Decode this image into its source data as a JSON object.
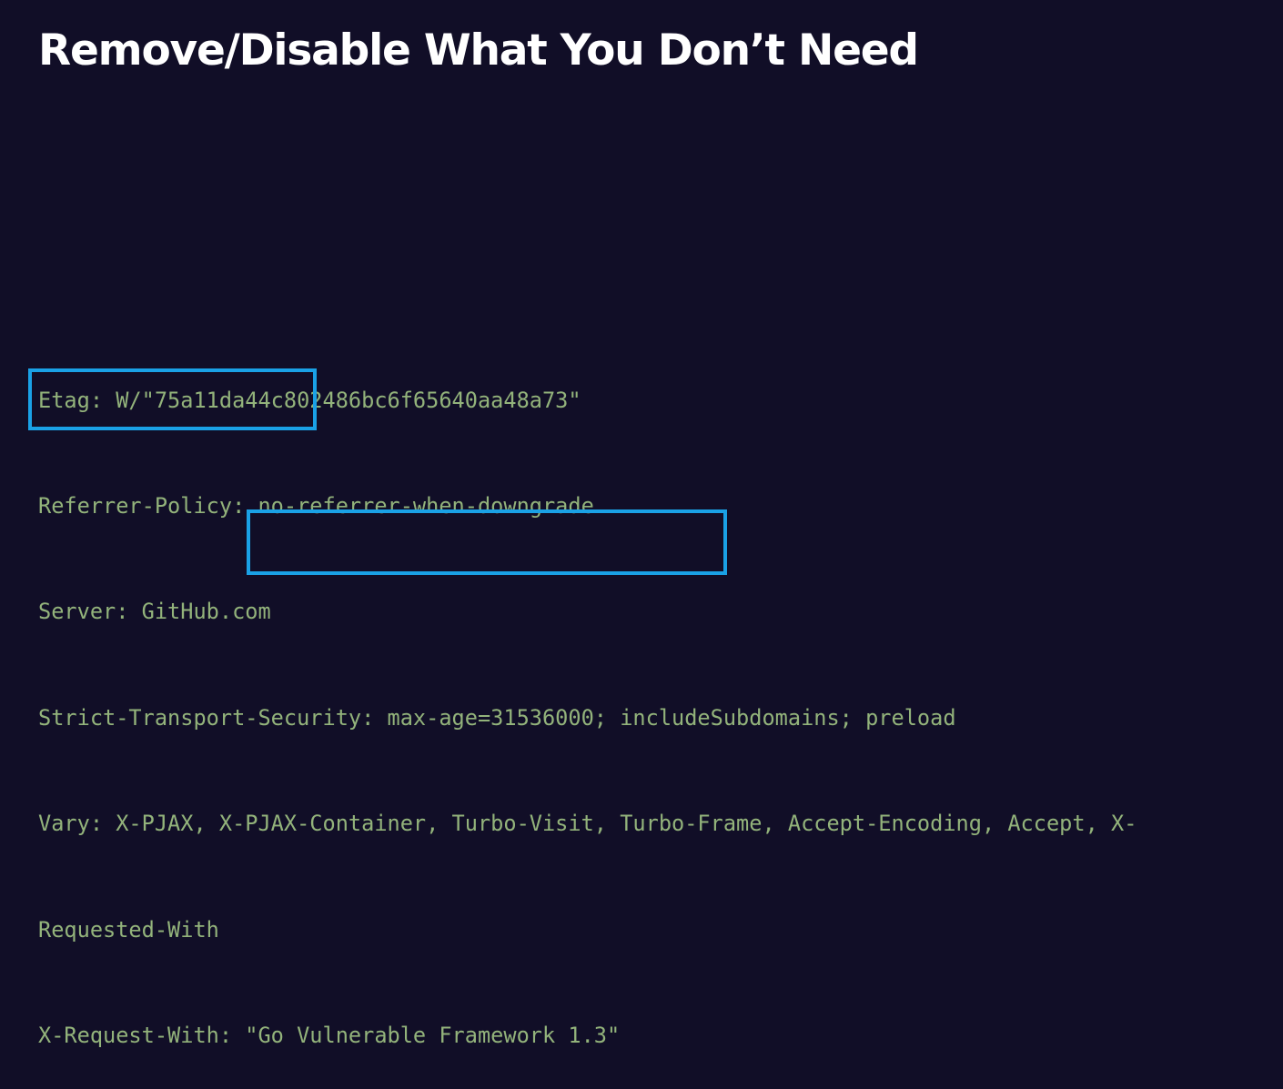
{
  "slide": {
    "title": "Remove/Disable What You Don’t Need"
  },
  "headers": {
    "lines": [
      "Etag: W/\"75a11da44c802486bc6f65640aa48a73\"",
      "Referrer-Policy: no-referrer-when-downgrade",
      "Server: GitHub.com",
      "Strict-Transport-Security: max-age=31536000; includeSubdomains; preload",
      "Vary: X-PJAX, X-PJAX-Container, Turbo-Visit, Turbo-Frame, Accept-Encoding, Accept, X-",
      "Requested-With",
      "X-Request-With: \"Go Vulnerable Framework 1.3\""
    ]
  },
  "colors": {
    "background": "#110e27",
    "title": "#ffffff",
    "code_text": "#93b37b",
    "highlight_border": "#1aa1e6"
  }
}
